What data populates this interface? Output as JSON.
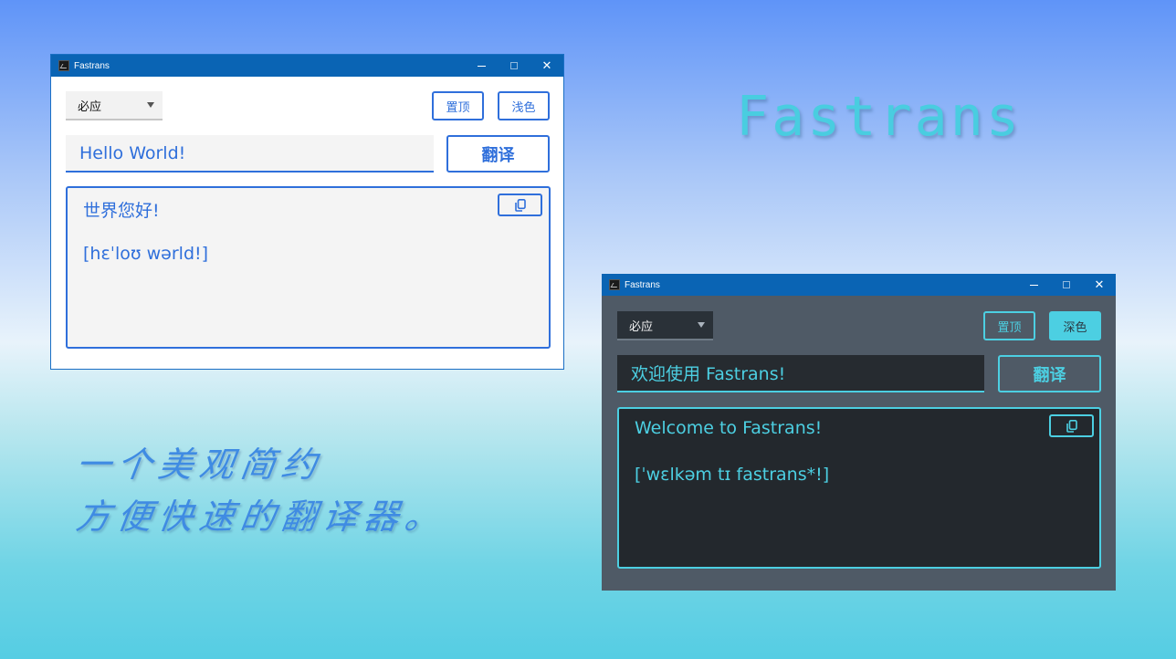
{
  "colors": {
    "titlebar": "#0a64b4",
    "light_accent": "#2f6fdb",
    "dark_accent": "#4ccfe2",
    "dark_window_bg": "#4f5a66"
  },
  "light_window": {
    "title": "Fastrans",
    "app_icon": "fastrans-app-icon",
    "controls": {
      "minimize": "minimize-icon",
      "maximize": "maximize-icon",
      "close": "close-icon"
    },
    "engine_selected": "必应",
    "pin_label": "置顶",
    "theme_label": "浅色",
    "input_value": "Hello World!",
    "translate_label": "翻译",
    "result_translation": "世界您好!",
    "result_phonetic": "[hɛˈloʊ wərld!]",
    "copy_icon": "copy-icon"
  },
  "dark_window": {
    "title": "Fastrans",
    "app_icon": "fastrans-app-icon",
    "controls": {
      "minimize": "minimize-icon",
      "maximize": "maximize-icon",
      "close": "close-icon"
    },
    "engine_selected": "必应",
    "pin_label": "置顶",
    "theme_label": "深色",
    "input_value": "欢迎使用 Fastrans!",
    "translate_label": "翻译",
    "result_translation": "Welcome to Fastrans!",
    "result_phonetic": "[ˈwɛlkəm tɪ fastrans*!]",
    "copy_icon": "copy-icon"
  },
  "branding": {
    "title": "Fastrans",
    "slogan_line1": "一个美观简约",
    "slogan_line2": "方便快速的翻译器。"
  }
}
